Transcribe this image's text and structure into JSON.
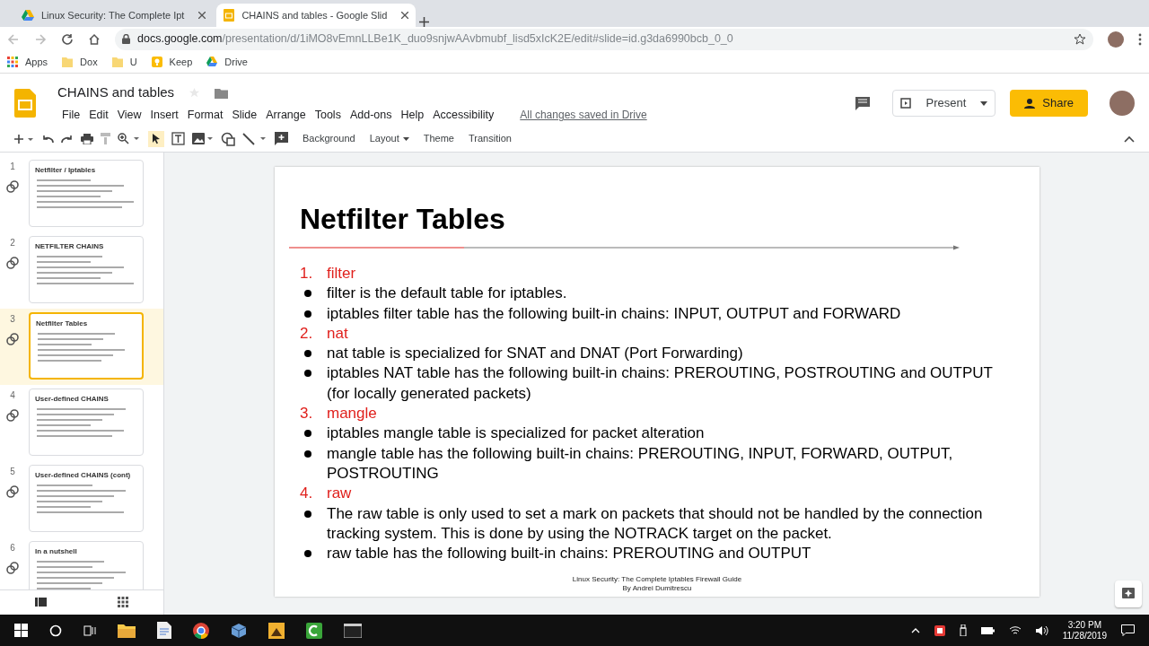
{
  "browser": {
    "tabs": [
      {
        "title": "Linux Security: The Complete Ipt",
        "selected": false
      },
      {
        "title": "CHAINS and tables - Google Slid",
        "selected": true
      }
    ],
    "url_host": "docs.google.com",
    "url_path": "/presentation/d/1iMO8vEmnLLBe1K_duo9snjwAAvbmubf_lisd5xIcK2E/edit#slide=id.g3da6990bcb_0_0",
    "bookmarks": [
      {
        "label": "Apps",
        "kind": "apps"
      },
      {
        "label": "Dox",
        "kind": "folder"
      },
      {
        "label": "U",
        "kind": "folder"
      },
      {
        "label": "Keep",
        "kind": "keep"
      },
      {
        "label": "Drive",
        "kind": "drive"
      }
    ]
  },
  "document": {
    "title": "CHAINS and tables",
    "menu": [
      "File",
      "Edit",
      "View",
      "Insert",
      "Format",
      "Slide",
      "Arrange",
      "Tools",
      "Add-ons",
      "Help",
      "Accessibility"
    ],
    "save_status": "All changes saved in Drive",
    "present": "Present",
    "share": "Share"
  },
  "toolbar": {
    "buttons": [
      {
        "label": "Background",
        "dropdown": false
      },
      {
        "label": "Layout",
        "dropdown": true
      },
      {
        "label": "Theme",
        "dropdown": false
      },
      {
        "label": "Transition",
        "dropdown": false
      }
    ]
  },
  "thumbnails": [
    {
      "number": "1",
      "title": "Netfilter / Iptables",
      "selected": false
    },
    {
      "number": "2",
      "title": "NETFILTER CHAINS",
      "selected": false
    },
    {
      "number": "3",
      "title": "Netfilter Tables",
      "selected": true
    },
    {
      "number": "4",
      "title": "User-defined CHAINS",
      "selected": false
    },
    {
      "number": "5",
      "title": "User-defined CHAINS (cont)",
      "selected": false
    },
    {
      "number": "6",
      "title": "In a nutshell",
      "selected": false
    }
  ],
  "slide": {
    "title": "Netfilter Tables",
    "items": [
      {
        "kind": "numbered",
        "number": "1.",
        "text": "filter"
      },
      {
        "kind": "bullet",
        "text": "filter is the default table for iptables."
      },
      {
        "kind": "bullet",
        "text": "iptables filter table has the following built-in chains: INPUT, OUTPUT and FORWARD"
      },
      {
        "kind": "numbered",
        "number": "2.",
        "text": "nat"
      },
      {
        "kind": "bullet",
        "text": "nat table is specialized for SNAT and DNAT (Port Forwarding)"
      },
      {
        "kind": "bullet",
        "text": "iptables NAT table has the following built-in chains: PREROUTING, POSTROUTING and OUTPUT (for locally generated packets)"
      },
      {
        "kind": "numbered",
        "number": "3.",
        "text": "mangle"
      },
      {
        "kind": "bullet",
        "text": "iptables mangle table is specialized for packet alteration"
      },
      {
        "kind": "bullet",
        "text": "mangle table has the following built-in chains: PREROUTING, INPUT, FORWARD, OUTPUT, POSTROUTING"
      },
      {
        "kind": "numbered",
        "number": "4.",
        "text": "raw"
      },
      {
        "kind": "bullet",
        "text": "The raw table is only used to set a mark on packets that should not be handled by the connection tracking system. This is done by using the NOTRACK target on the packet."
      },
      {
        "kind": "bullet",
        "text": "raw table has the following built-in chains: PREROUTING and OUTPUT"
      }
    ],
    "footer": [
      "Linux Security: The Complete Iptables Firewall Guide",
      "By Andrei Dumitrescu"
    ]
  },
  "taskbar": {
    "time": "3:20 PM",
    "date": "11/28/2019"
  }
}
